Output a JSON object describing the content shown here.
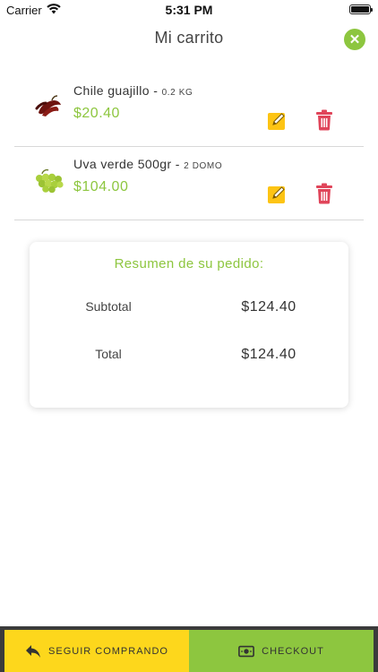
{
  "status_bar": {
    "carrier": "Carrier",
    "time": "5:31 PM"
  },
  "header": {
    "title": "Mi carrito",
    "close_glyph": "✕"
  },
  "cart": {
    "items": [
      {
        "name": "Chile guajillo - ",
        "quantity": "0.2 KG",
        "price": "$20.40"
      },
      {
        "name": "Uva verde 500gr - ",
        "quantity": "2 DOMO",
        "price": "$104.00"
      }
    ]
  },
  "summary": {
    "title": "Resumen de su pedido:",
    "subtotal_label": "Subtotal",
    "subtotal_value": "$124.40",
    "total_label": "Total",
    "total_value": "$124.40"
  },
  "footer": {
    "continue_label": "SEGUIR COMPRANDO",
    "checkout_label": "CHECKOUT"
  },
  "colors": {
    "accent_green": "#8dc63f",
    "accent_yellow": "#fdd71c",
    "delete_red": "#e0455a",
    "bottom_bar": "#3b3b3b"
  },
  "icons": [
    "wifi-icon",
    "battery-icon",
    "close-icon",
    "edit-icon",
    "trash-icon",
    "reply-arrow-icon",
    "money-icon"
  ]
}
